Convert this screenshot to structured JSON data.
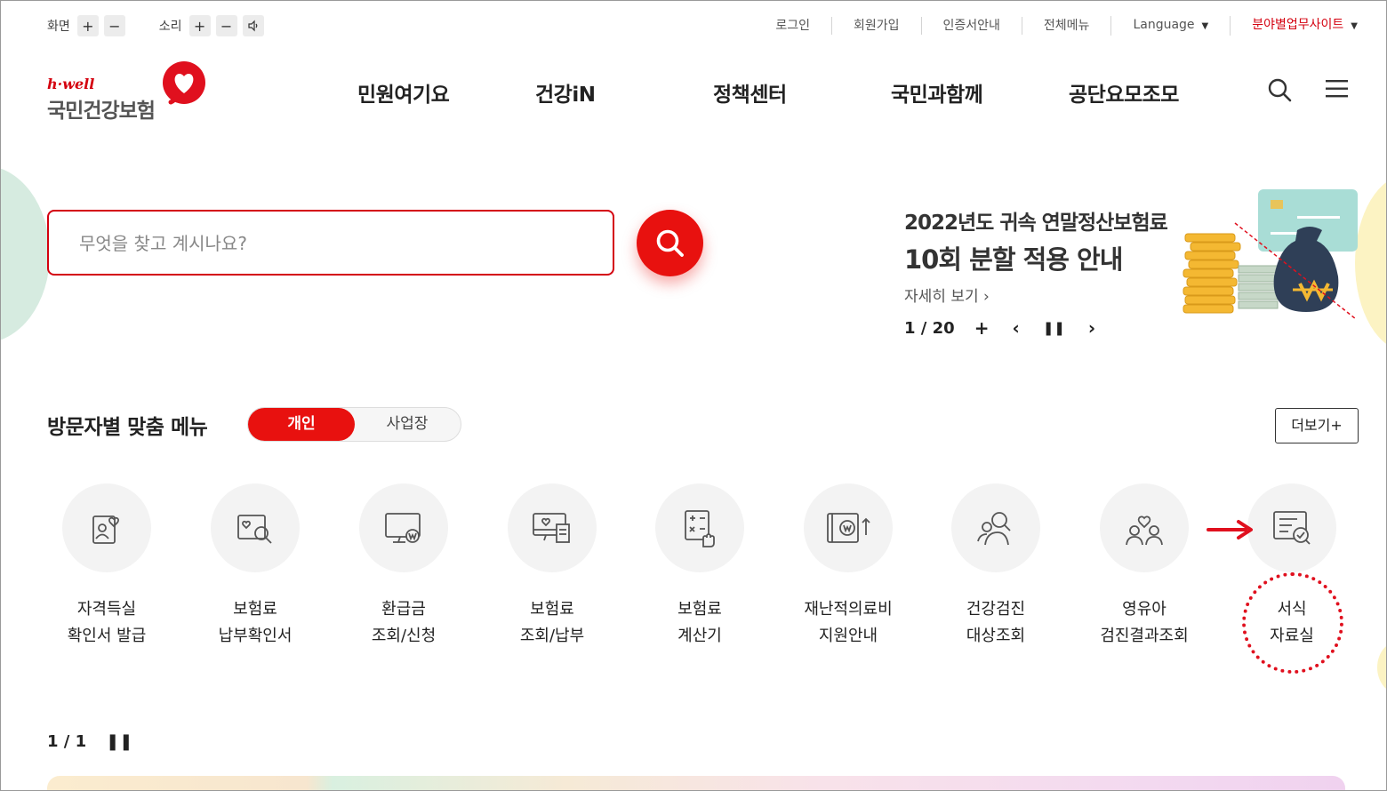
{
  "utility": {
    "screen_label": "화면",
    "sound_label": "소리",
    "plus": "+",
    "minus": "−",
    "links": [
      "로그인",
      "회원가입",
      "인증서안내",
      "전체메뉴"
    ],
    "language": "Language",
    "field_sites": "분야별업무사이트"
  },
  "logo": {
    "sub": "h·well",
    "main": "국민건강보험"
  },
  "nav": {
    "items": [
      "민원여기요",
      "건강iN",
      "정책센터",
      "국민과함께",
      "공단요모조모"
    ]
  },
  "search": {
    "placeholder": "무엇을 찾고 계시나요?"
  },
  "banner": {
    "title_line1": "2022년도 귀속 연말정산보험료",
    "title_line2": "10회 분할 적용 안내",
    "more": "자세히 보기 ›",
    "page": "1 / 20",
    "plus": "+",
    "prev": "‹",
    "pause": "❚❚",
    "next": "›"
  },
  "visitor_menu": {
    "title": "방문자별 맞춤 메뉴",
    "tab_personal": "개인",
    "tab_business": "사업장",
    "more": "더보기+",
    "items": [
      {
        "line1": "자격득실",
        "line2": "확인서 발급",
        "icon": "qualification-certificate-icon"
      },
      {
        "line1": "보험료",
        "line2": "납부확인서",
        "icon": "payment-certificate-icon"
      },
      {
        "line1": "환급금",
        "line2": "조회/신청",
        "icon": "refund-icon"
      },
      {
        "line1": "보험료",
        "line2": "조회/납부",
        "icon": "premium-payment-icon"
      },
      {
        "line1": "보험료",
        "line2": "계산기",
        "icon": "calculator-icon"
      },
      {
        "line1": "재난적의료비",
        "line2": "지원안내",
        "icon": "medical-support-icon"
      },
      {
        "line1": "건강검진",
        "line2": "대상조회",
        "icon": "checkup-target-icon"
      },
      {
        "line1": "영유아",
        "line2": "검진결과조회",
        "icon": "infant-checkup-icon"
      },
      {
        "line1": "서식",
        "line2": "자료실",
        "icon": "forms-library-icon"
      }
    ],
    "pager": "1 / 1",
    "pause": "❚❚"
  },
  "colors": {
    "brand_red": "#e8110f",
    "annotation_red": "#e0101e"
  }
}
